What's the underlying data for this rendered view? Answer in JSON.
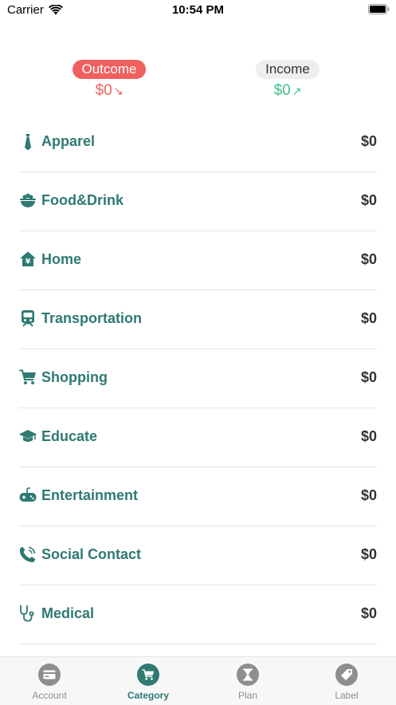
{
  "status_bar": {
    "carrier": "Carrier",
    "time": "10:54 PM"
  },
  "summary": {
    "outcome": {
      "label": "Outcome",
      "amount": "$0",
      "arrow": "↘"
    },
    "income": {
      "label": "Income",
      "amount": "$0",
      "arrow": "↗"
    }
  },
  "categories": [
    {
      "label": "Apparel",
      "value": "$0",
      "icon": "tie-icon"
    },
    {
      "label": "Food&Drink",
      "value": "$0",
      "icon": "bowl-icon"
    },
    {
      "label": "Home",
      "value": "$0",
      "icon": "home-icon"
    },
    {
      "label": "Transportation",
      "value": "$0",
      "icon": "train-icon"
    },
    {
      "label": "Shopping",
      "value": "$0",
      "icon": "cart-icon"
    },
    {
      "label": "Educate",
      "value": "$0",
      "icon": "graduation-cap-icon"
    },
    {
      "label": "Entertainment",
      "value": "$0",
      "icon": "gamepad-icon"
    },
    {
      "label": "Social Contact",
      "value": "$0",
      "icon": "phone-icon"
    },
    {
      "label": "Medical",
      "value": "$0",
      "icon": "stethoscope-icon"
    }
  ],
  "tabs": [
    {
      "label": "Account",
      "icon": "card-icon",
      "active": false
    },
    {
      "label": "Category",
      "icon": "cart-icon",
      "active": true
    },
    {
      "label": "Plan",
      "icon": "hourglass-icon",
      "active": false
    },
    {
      "label": "Label",
      "icon": "tag-icon",
      "active": false
    }
  ],
  "colors": {
    "accent": "#2f7a72",
    "outcome": "#f0605f",
    "income": "#3dc18a",
    "inactive": "#8e8e8e"
  }
}
